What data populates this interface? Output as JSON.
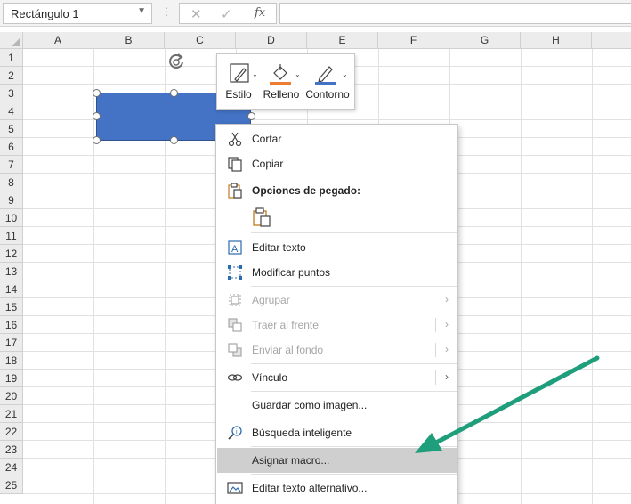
{
  "formula_bar": {
    "name_box": "Rectángulo 1",
    "fx_label": "fx"
  },
  "columns": [
    "A",
    "B",
    "C",
    "D",
    "E",
    "F",
    "G",
    "H"
  ],
  "rows": [
    "1",
    "2",
    "3",
    "4",
    "5",
    "6",
    "7",
    "8",
    "9",
    "10",
    "11",
    "12",
    "13",
    "14",
    "15",
    "16",
    "17",
    "18",
    "19",
    "20",
    "21",
    "22",
    "23",
    "24",
    "25"
  ],
  "mini_toolbar": {
    "style_label": "Estilo",
    "fill_label": "Relleno",
    "outline_label": "Contorno",
    "fill_color": "#ed7d31",
    "outline_color": "#4472c4"
  },
  "shape": {
    "name": "Rectángulo 1",
    "fill_color": "#4472c4"
  },
  "context_menu": {
    "items": [
      {
        "label": "Cortar",
        "icon": "scissors-icon",
        "enabled": true
      },
      {
        "label": "Copiar",
        "icon": "copy-icon",
        "enabled": true
      },
      {
        "label": "Opciones de pegado:",
        "icon": "clipboard-icon",
        "enabled": true
      },
      {
        "label": "Editar texto",
        "icon": "edit-text-icon",
        "enabled": true
      },
      {
        "label": "Modificar puntos",
        "icon": "edit-points-icon",
        "enabled": true
      },
      {
        "label": "Agrupar",
        "icon": "group-icon",
        "enabled": false
      },
      {
        "label": "Traer al frente",
        "icon": "bring-front-icon",
        "enabled": false
      },
      {
        "label": "Enviar al fondo",
        "icon": "send-back-icon",
        "enabled": false
      },
      {
        "label": "Vínculo",
        "icon": "link-icon",
        "enabled": true
      },
      {
        "label": "Guardar como imagen...",
        "icon": "",
        "enabled": true
      },
      {
        "label": "Búsqueda inteligente",
        "icon": "smart-lookup-icon",
        "enabled": true
      },
      {
        "label": "Asignar macro...",
        "icon": "",
        "enabled": true,
        "highlighted": true
      },
      {
        "label": "Editar texto alternativo...",
        "icon": "alt-text-icon",
        "enabled": true
      }
    ]
  },
  "annotation": {
    "arrow_color": "#1e9e7a"
  }
}
